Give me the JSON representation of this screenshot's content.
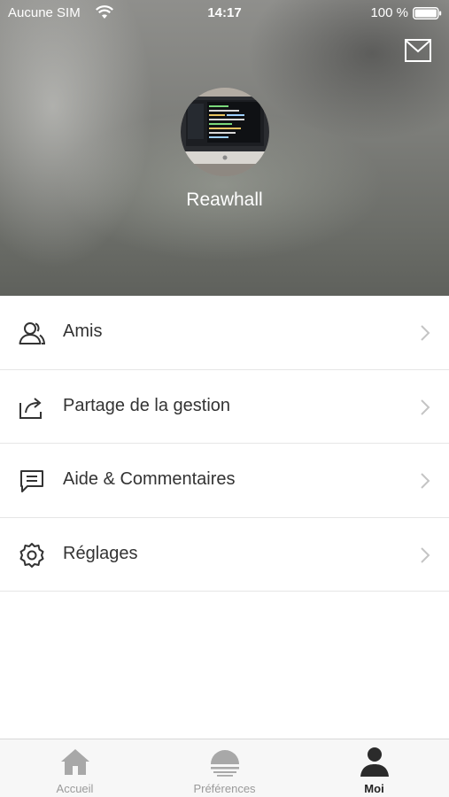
{
  "status_bar": {
    "carrier": "Aucune SIM",
    "time": "14:17",
    "battery": "100 %"
  },
  "profile": {
    "username": "Reawhall",
    "mail_icon": "envelope-icon"
  },
  "menu": [
    {
      "label": "Amis",
      "icon": "friends-icon"
    },
    {
      "label": "Partage de la gestion",
      "icon": "share-icon"
    },
    {
      "label": "Aide & Commentaires",
      "icon": "chat-icon"
    },
    {
      "label": "Réglages",
      "icon": "gear-icon"
    }
  ],
  "tab_bar": {
    "tabs": [
      {
        "label": "Accueil",
        "icon": "home-icon",
        "active": false
      },
      {
        "label": "Préférences",
        "icon": "sunset-icon",
        "active": false
      },
      {
        "label": "Moi",
        "icon": "person-icon",
        "active": true
      }
    ]
  },
  "colors": {
    "text": "#333333",
    "tab_inactive": "#9a9a9a",
    "tab_active": "#222222",
    "divider": "#e6e6e6"
  }
}
